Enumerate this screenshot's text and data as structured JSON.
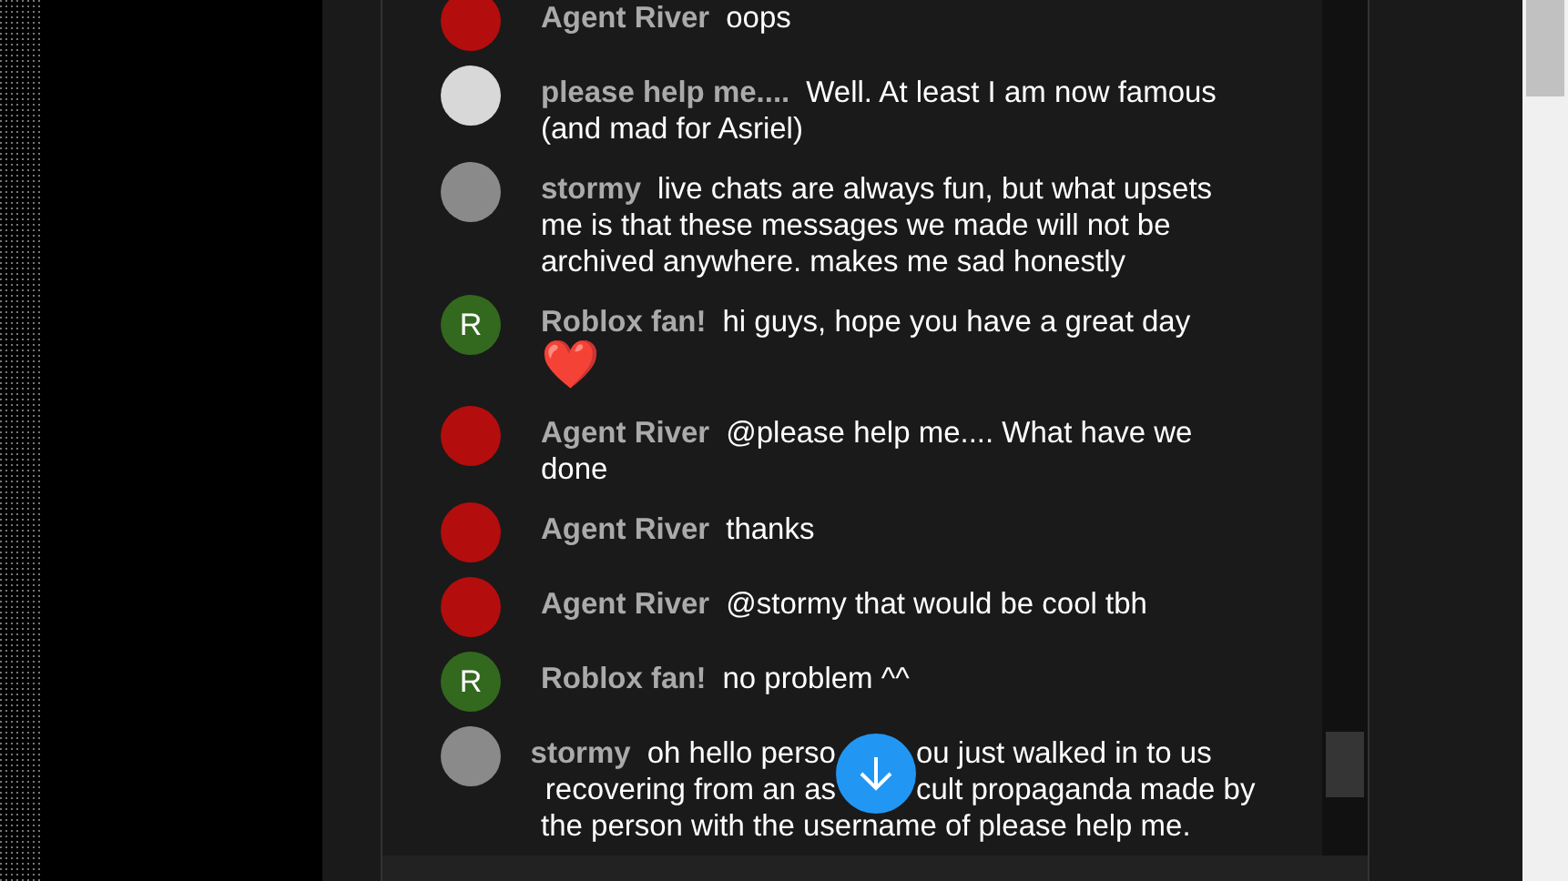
{
  "messages": [
    {
      "author": "Agent River",
      "text": "oops",
      "avatar": {
        "kind": "photo",
        "color": "#b30d0d"
      }
    },
    {
      "author": "please help me....",
      "text": "Well. At least I am now famous (and mad for Asriel)",
      "avatar": {
        "kind": "photo",
        "color": "#d8d8d8"
      }
    },
    {
      "author": "stormy",
      "text": "live chats are always fun, but what upsets me is that these messages we made will not be archived anywhere. makes me sad honestly",
      "avatar": {
        "kind": "photo",
        "color": "#8a8a8a"
      }
    },
    {
      "author": "Roblox fan!",
      "text": "hi guys, hope you have a great day",
      "emoji": "❤️",
      "avatar": {
        "kind": "letter",
        "letter": "R",
        "color": "#33691e"
      }
    },
    {
      "author": "Agent River",
      "text": "@please help me.... What have we done",
      "avatar": {
        "kind": "photo",
        "color": "#b30d0d"
      }
    },
    {
      "author": "Agent River",
      "text": "thanks",
      "avatar": {
        "kind": "photo",
        "color": "#b30d0d"
      }
    },
    {
      "author": "Agent River",
      "text": "@stormy that would be cool tbh",
      "avatar": {
        "kind": "photo",
        "color": "#b30d0d"
      }
    },
    {
      "author": "Roblox fan!",
      "text": "no problem ^^",
      "avatar": {
        "kind": "letter",
        "letter": "R",
        "color": "#33691e"
      }
    },
    {
      "author": "stormy",
      "lines": [
        [
          "oh hello perso",
          "ou just walked in to us"
        ],
        [
          "recovering from an as",
          "cult propaganda made by"
        ],
        [
          "the person with the username of please help me."
        ]
      ],
      "avatar": {
        "kind": "photo",
        "color": "#8a8a8a"
      }
    }
  ]
}
